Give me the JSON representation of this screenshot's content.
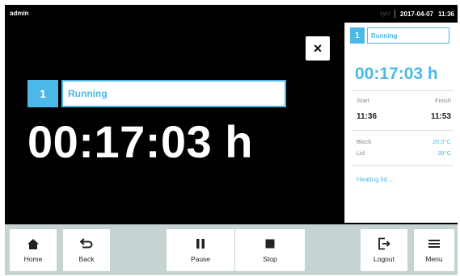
{
  "status_bar": {
    "user": "admin",
    "tag": "cycl",
    "date": "2017-04-07",
    "time": "11:36"
  },
  "main": {
    "close_label": "×",
    "block_number": "1",
    "status": "Running",
    "remaining_time": "00:17:03 h"
  },
  "panel": {
    "block_number": "1",
    "status": "Running",
    "remaining_time": "00:17:03 h",
    "start_label": "Start",
    "finish_label": "Finish",
    "start_time": "11:36",
    "finish_time": "11:53",
    "block_label": "Block",
    "block_temp": "20.0°C",
    "lid_label": "Lid",
    "lid_temp": "39°C",
    "heating_text": "Heating lid ..."
  },
  "toolbar": {
    "home": "Home",
    "back": "Back",
    "pause": "Pause",
    "stop": "Stop",
    "logout": "Logout",
    "menu": "Menu"
  },
  "colors": {
    "accent": "#4cb8e8",
    "background": "#000000",
    "toolbar": "#c6d3d3"
  },
  "icons": [
    "home-icon",
    "back-icon",
    "pause-icon",
    "stop-icon",
    "logout-icon",
    "menu-icon",
    "close-icon"
  ]
}
